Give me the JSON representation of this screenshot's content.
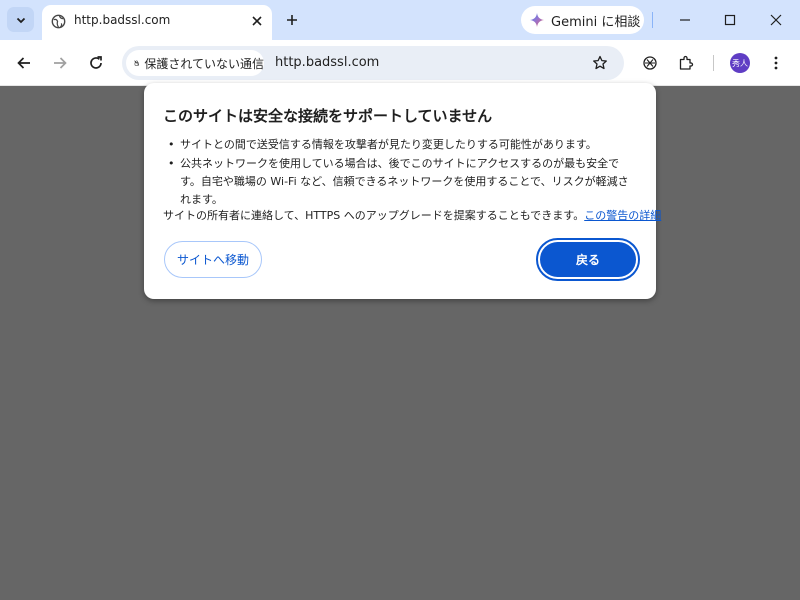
{
  "tab": {
    "title": "http.badssl.com"
  },
  "gemini": {
    "label": "Gemini に相談"
  },
  "omnibox": {
    "security_label": "保護されていない通信",
    "url": "http.badssl.com"
  },
  "profile": {
    "avatar_text": "秀人"
  },
  "dialog": {
    "title": "このサイトは安全な接続をサポートしていません",
    "bullets": [
      "サイトとの間で送受信する情報を攻撃者が見たり変更したりする可能性があります。",
      "公共ネットワークを使用している場合は、後でこのサイトにアクセスするのが最も安全です。自宅や職場の Wi-Fi など、信頼できるネットワークを使用することで、リスクが軽減されます。"
    ],
    "info_text": "サイトの所有者に連絡して、HTTPS へのアップグレードを提案することもできます。",
    "info_link": "この警告の詳細",
    "proceed_label": "サイトへ移動",
    "back_label": "戻る"
  },
  "colors": {
    "accent": "#0b57d0",
    "titlebar": "#d3e3fd",
    "backdrop": "#666666"
  }
}
